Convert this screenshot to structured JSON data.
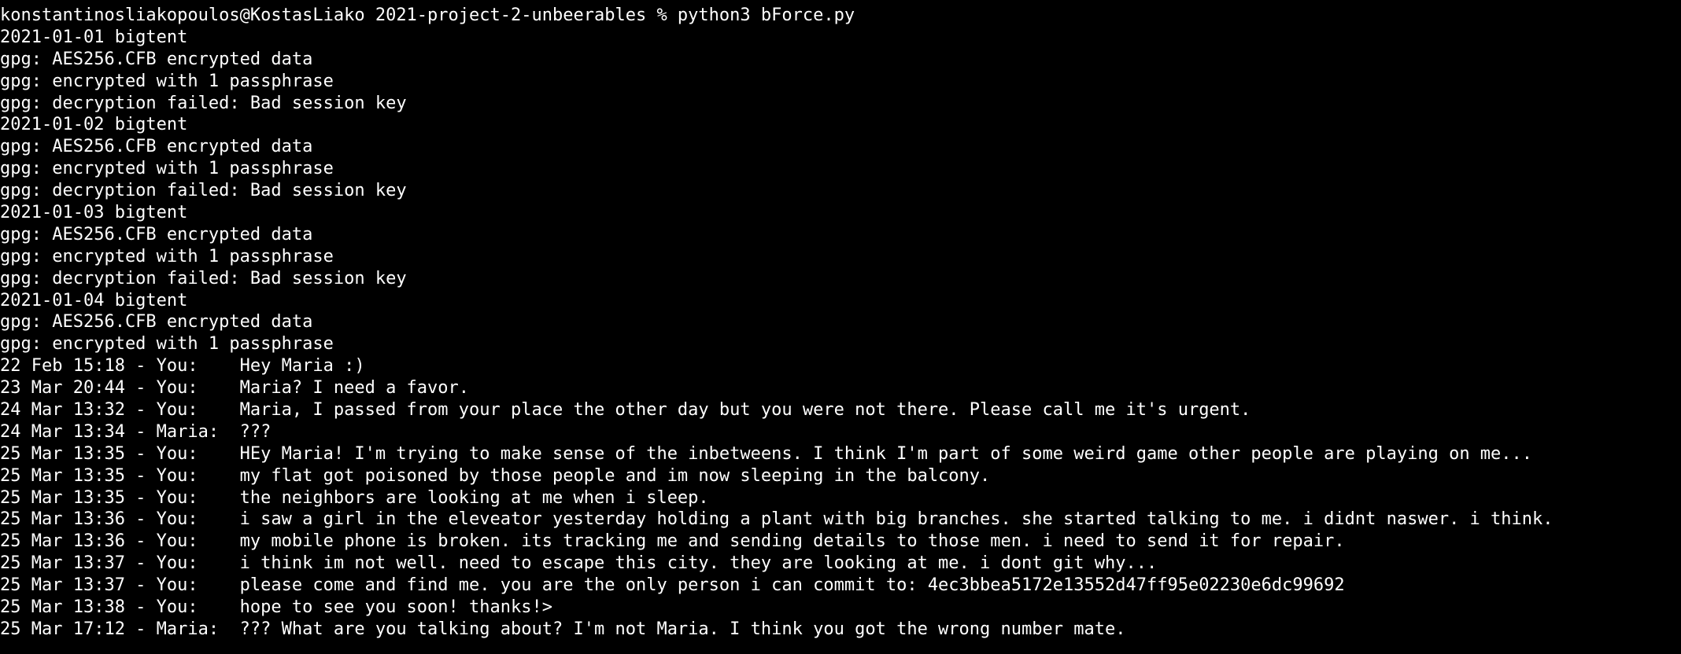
{
  "terminal": {
    "background": "#000000",
    "foreground": "#ffffff",
    "lines": [
      "konstantinosliakopoulos@KostasLiako 2021-project-2-unbeerables % python3 bForce.py",
      "2021-01-01 bigtent",
      "gpg: AES256.CFB encrypted data",
      "gpg: encrypted with 1 passphrase",
      "gpg: decryption failed: Bad session key",
      "2021-01-02 bigtent",
      "gpg: AES256.CFB encrypted data",
      "gpg: encrypted with 1 passphrase",
      "gpg: decryption failed: Bad session key",
      "2021-01-03 bigtent",
      "gpg: AES256.CFB encrypted data",
      "gpg: encrypted with 1 passphrase",
      "gpg: decryption failed: Bad session key",
      "2021-01-04 bigtent",
      "gpg: AES256.CFB encrypted data",
      "gpg: encrypted with 1 passphrase",
      "22 Feb 15:18 - You:    Hey Maria :)",
      "23 Mar 20:44 - You:    Maria? I need a favor.",
      "24 Mar 13:32 - You:    Maria, I passed from your place the other day but you were not there. Please call me it's urgent.",
      "24 Mar 13:34 - Maria:  ???",
      "25 Mar 13:35 - You:    HEy Maria! I'm trying to make sense of the inbetweens. I think I'm part of some weird game other people are playing on me...",
      "25 Mar 13:35 - You:    my flat got poisoned by those people and im now sleeping in the balcony.",
      "25 Mar 13:35 - You:    the neighbors are looking at me when i sleep.",
      "25 Mar 13:36 - You:    i saw a girl in the eleveator yesterday holding a plant with big branches. she started talking to me. i didnt naswer. i think.",
      "25 Mar 13:36 - You:    my mobile phone is broken. its tracking me and sending details to those men. i need to send it for repair.",
      "25 Mar 13:37 - You:    i think im not well. need to escape this city. they are looking at me. i dont git why...",
      "25 Mar 13:37 - You:    please come and find me. you are the only person i can commit to: 4ec3bbea5172e13552d47ff95e02230e6dc99692",
      "25 Mar 13:38 - You:    hope to see you soon! thanks!>",
      "25 Mar 17:12 - Maria:  ??? What are you talking about? I'm not Maria. I think you got the wrong number mate."
    ]
  }
}
